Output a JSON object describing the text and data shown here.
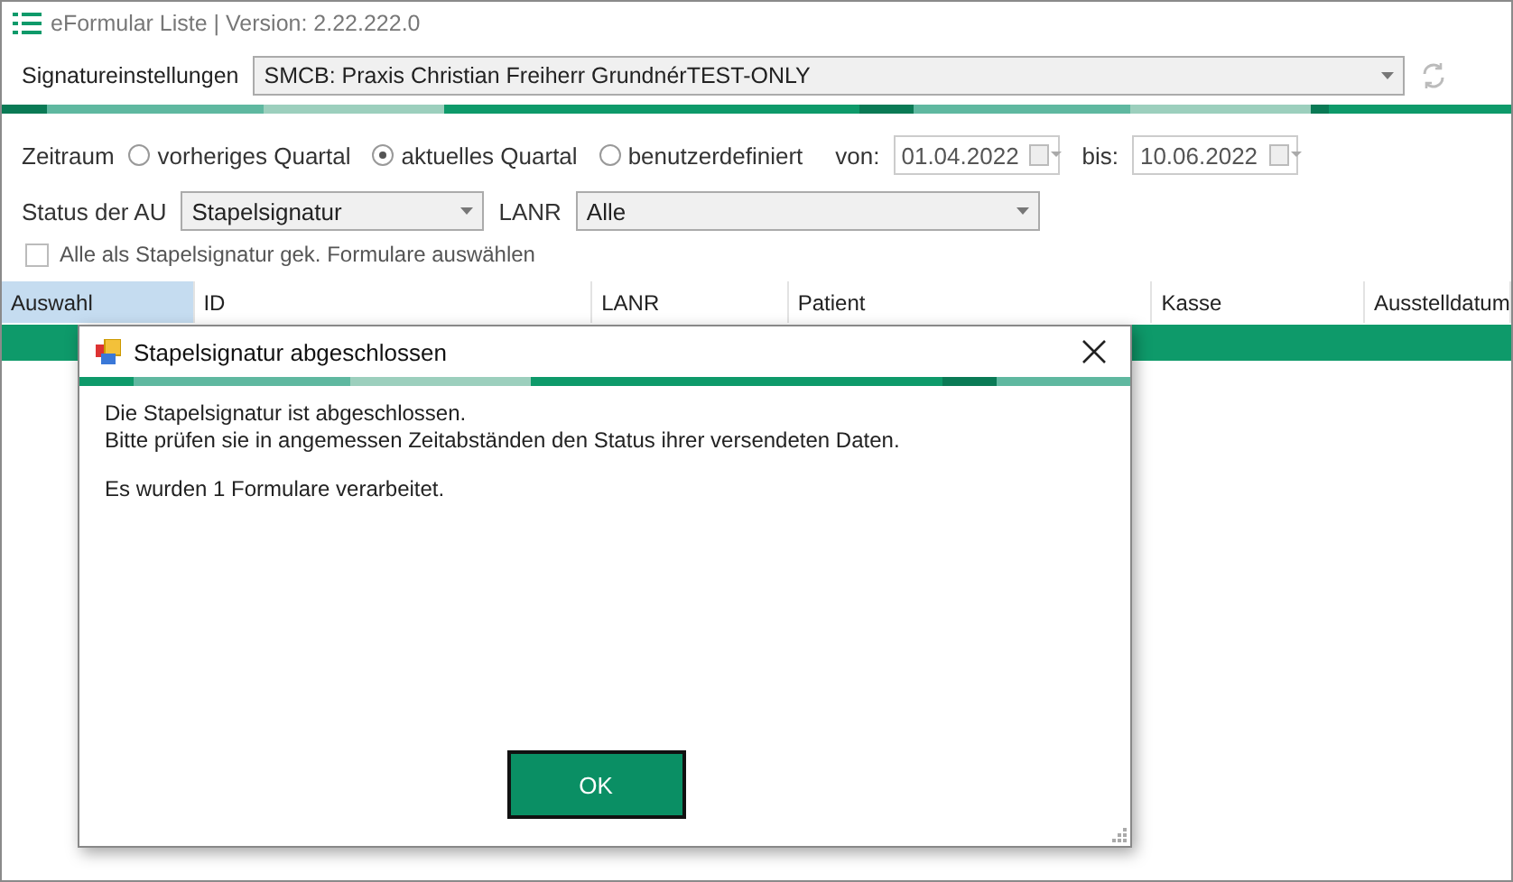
{
  "window": {
    "title": "eFormular Liste | Version: 2.22.222.0"
  },
  "signature": {
    "label": "Signatureinstellungen",
    "value": "SMCB: Praxis Christian Freiherr GrundnérTEST-ONLY"
  },
  "period": {
    "label": "Zeitraum",
    "options": [
      {
        "label": "vorheriges Quartal",
        "selected": false
      },
      {
        "label": "aktuelles Quartal",
        "selected": true
      },
      {
        "label": "benutzerdefiniert",
        "selected": false
      }
    ],
    "from_label": "von:",
    "from": "01.04.2022",
    "to_label": "bis:",
    "to": "10.06.2022"
  },
  "status": {
    "label": "Status der AU",
    "value": "Stapelsignatur"
  },
  "lanr": {
    "label": "LANR",
    "value": "Alle"
  },
  "select_all": {
    "label": "Alle als Stapelsignatur gek. Formulare auswählen",
    "checked": false
  },
  "table": {
    "columns": [
      {
        "label": "Auswahl",
        "selected": true
      },
      {
        "label": "ID",
        "selected": false
      },
      {
        "label": "LANR",
        "selected": false
      },
      {
        "label": "Patient",
        "selected": false
      },
      {
        "label": "Kasse",
        "selected": false
      },
      {
        "label": "Ausstelldatum",
        "selected": false
      }
    ],
    "rows": [
      {
        "selected": true
      }
    ]
  },
  "dialog": {
    "title": "Stapelsignatur abgeschlossen",
    "paragraphs": [
      [
        "Die Stapelsignatur ist abgeschlossen.",
        "Bitte prüfen sie in angemessen Zeitabständen den Status ihrer versendeten Daten."
      ],
      [
        "Es wurden 1 Formulare verarbeitet."
      ]
    ],
    "button": "OK"
  }
}
